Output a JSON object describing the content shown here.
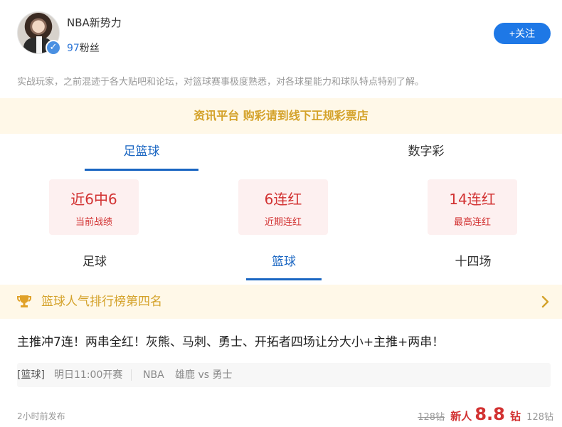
{
  "profile": {
    "name": "NBA新势力",
    "fans_count": "97",
    "fans_label": "粉丝",
    "follow_label": "+关注",
    "verified_icon": "check-icon"
  },
  "bio": "实战玩家，之前混迹于各大贴吧和论坛，对篮球赛事极度熟悉，对各球星能力和球队特点特别了解。",
  "notice": "资讯平台 购彩请到线下正规彩票店",
  "main_tabs": [
    {
      "label": "足篮球",
      "active": true
    },
    {
      "label": "数字彩",
      "active": false
    }
  ],
  "stats": [
    {
      "value": "近6中6",
      "label": "当前战绩"
    },
    {
      "value": "6连红",
      "label": "近期连红"
    },
    {
      "value": "14连红",
      "label": "最高连红"
    }
  ],
  "sub_tabs": [
    {
      "label": "足球",
      "active": false
    },
    {
      "label": "篮球",
      "active": true
    },
    {
      "label": "十四场",
      "active": false
    }
  ],
  "rank": {
    "text": "篮球人气排行榜第四名",
    "icon": "trophy-icon"
  },
  "article": {
    "headline": "主推冲7连！两串全红！灰熊、马刺、勇士、开拓者四场让分大小+主推+两串！",
    "match": {
      "tag": "[篮球]",
      "time": "明日11:00开赛",
      "league": "NBA",
      "teams": "雄鹿 vs 勇士"
    },
    "posted": "2小时前发布",
    "price": {
      "original": "128钻",
      "new_label": "新人",
      "new_value": "8.8",
      "unit": "钻",
      "original2": "128钻"
    }
  },
  "colors": {
    "accent_blue": "#1a66c2",
    "follow_button": "#1e78e6",
    "stat_red": "#d23232",
    "notice_gold": "#d4a22a",
    "notice_bg": "#fff8e8"
  }
}
